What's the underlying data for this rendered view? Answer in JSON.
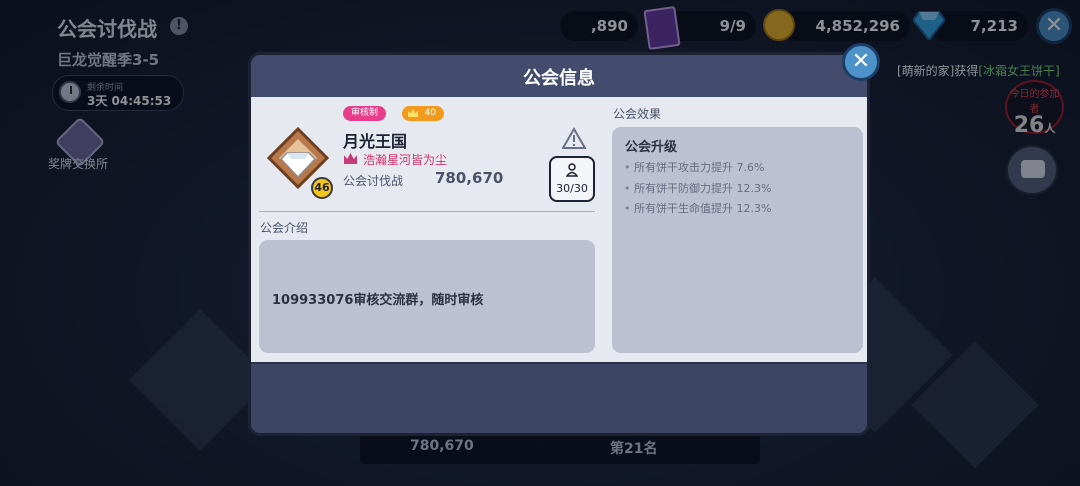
{
  "hud": {
    "event_title": "公会讨伐战",
    "season": "巨龙觉醒季3-5",
    "timer_label": "剩余时间",
    "timer_value": "3天 04:45:53",
    "medal_label": "奖牌交换所",
    "resource_partial": ",890",
    "cards": "9/9",
    "coins": "4,852,296",
    "gems": "7,213",
    "ticker_prefix": "[萌新的家]获得",
    "ticker_item": "[冰霜女王饼干]",
    "daily_label": "今日的参加者",
    "daily_count": "26",
    "daily_unit": "人",
    "bottom_score": "780,670",
    "bottom_rank": "第21名"
  },
  "modal": {
    "title": "公会信息",
    "badge_approval": "审核制",
    "badge_level": "40",
    "emblem_level": "46",
    "guild_name": "月光王国",
    "leader_name": "浩瀚星河皆为尘",
    "score_label": "公会讨伐战",
    "score_value": "780,670",
    "member_count": "30/30",
    "intro_label": "公会介绍",
    "intro_text": "109933076审核交流群，随时审核",
    "effect_label": "公会效果",
    "effect_title": "公会升级",
    "effects": [
      "所有饼干攻击力提升 7.6%",
      "所有饼干防御力提升 12.3%",
      "所有饼干生命值提升 12.3%"
    ]
  },
  "colors": {
    "accent_blue": "#4d92c9",
    "approval_pink": "#e83d8b",
    "level_orange": "#f29a1d",
    "leader_pink": "#d2346e"
  }
}
